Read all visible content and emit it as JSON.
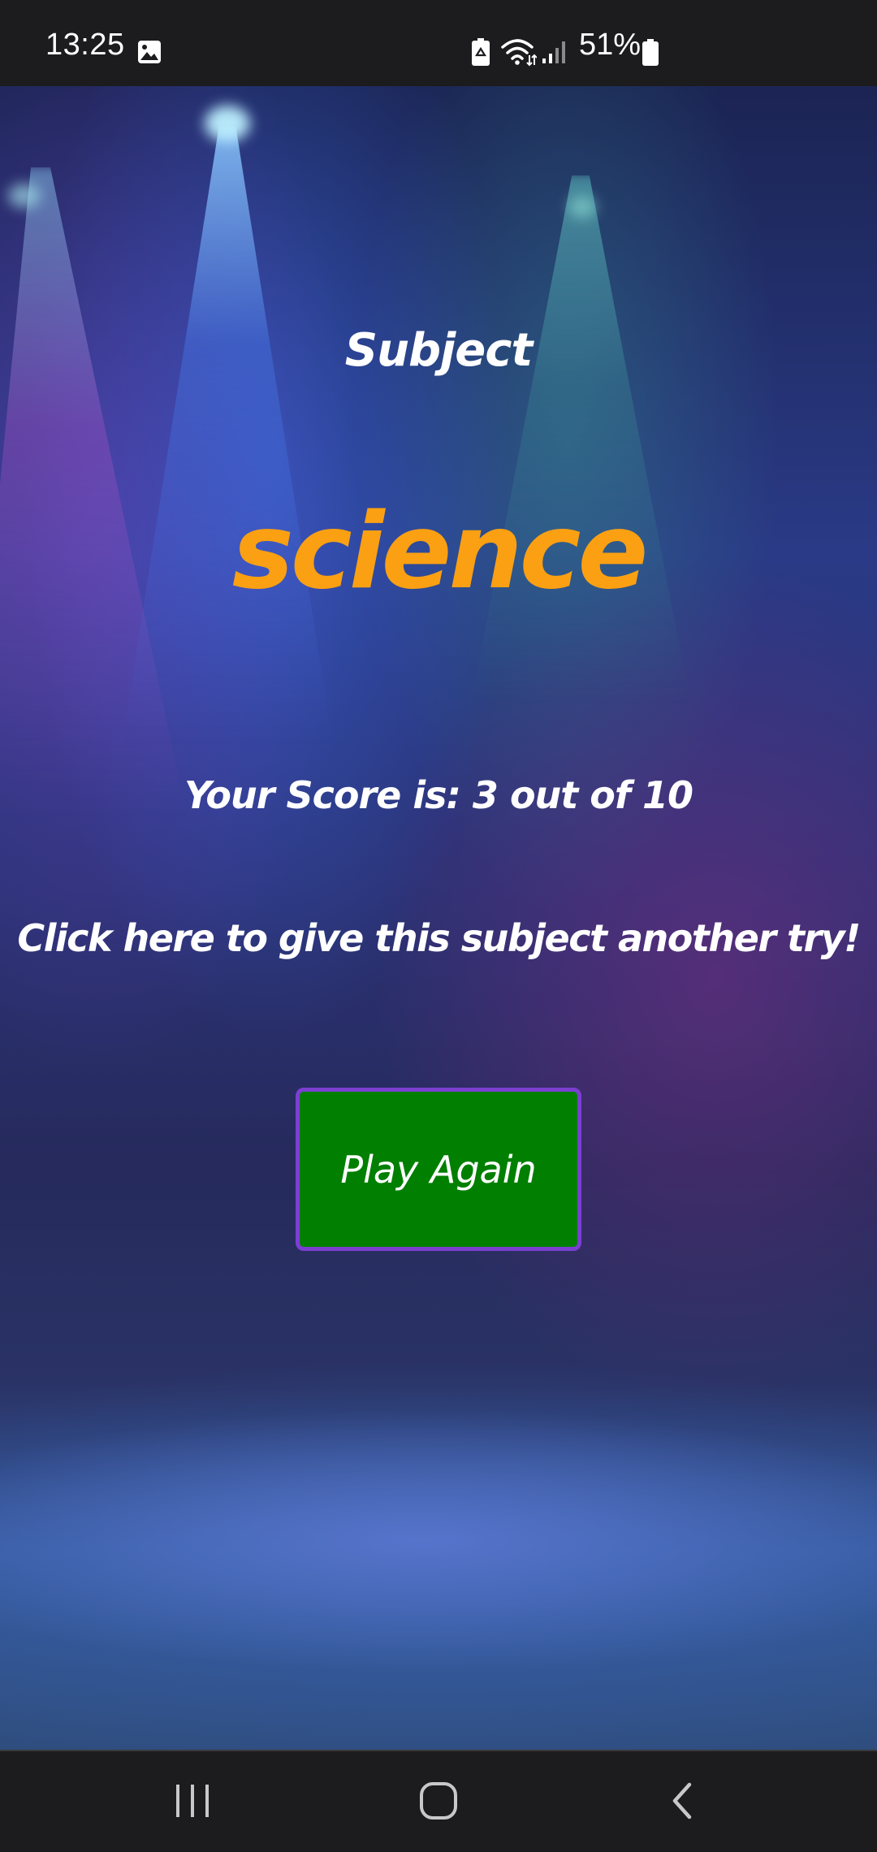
{
  "status_bar": {
    "time": "13:25",
    "battery_percent": "51%",
    "icons": [
      "image-icon",
      "battery-saver-icon",
      "wifi-icon",
      "signal-icon",
      "battery-icon"
    ]
  },
  "quiz_result": {
    "subject_label": "Subject",
    "subject_name": "science",
    "score_text": "Your Score is: 3 out of 10",
    "retry_prompt": "Click here to give this subject another try!",
    "play_again_label": "Play Again"
  },
  "navigation_bar": {
    "buttons": [
      "recent-apps-icon",
      "home-icon",
      "back-icon"
    ]
  },
  "colors": {
    "subject_name": "#fba012",
    "button_background": "#007f00",
    "button_border": "#7b3fd0",
    "text": "#ffffff",
    "system_bars": "#1c1b1d"
  }
}
